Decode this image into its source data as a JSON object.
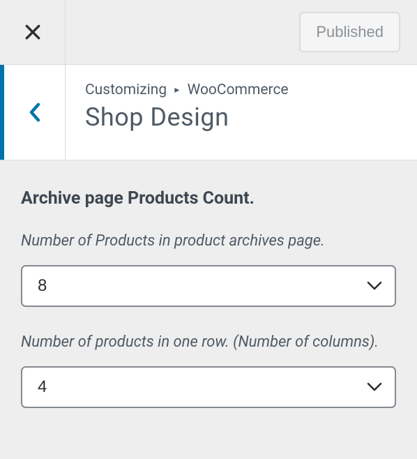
{
  "header": {
    "published_label": "Published",
    "breadcrumb_prefix": "Customizing",
    "breadcrumb_section": "WooCommerce",
    "page_title": "Shop Design"
  },
  "section": {
    "heading": "Archive page Products Count."
  },
  "controls": {
    "products_count": {
      "label": "Number of Products in product archives page.",
      "value": "8"
    },
    "columns": {
      "label": "Number of products in one row. (Number of columns).",
      "value": "4"
    }
  }
}
